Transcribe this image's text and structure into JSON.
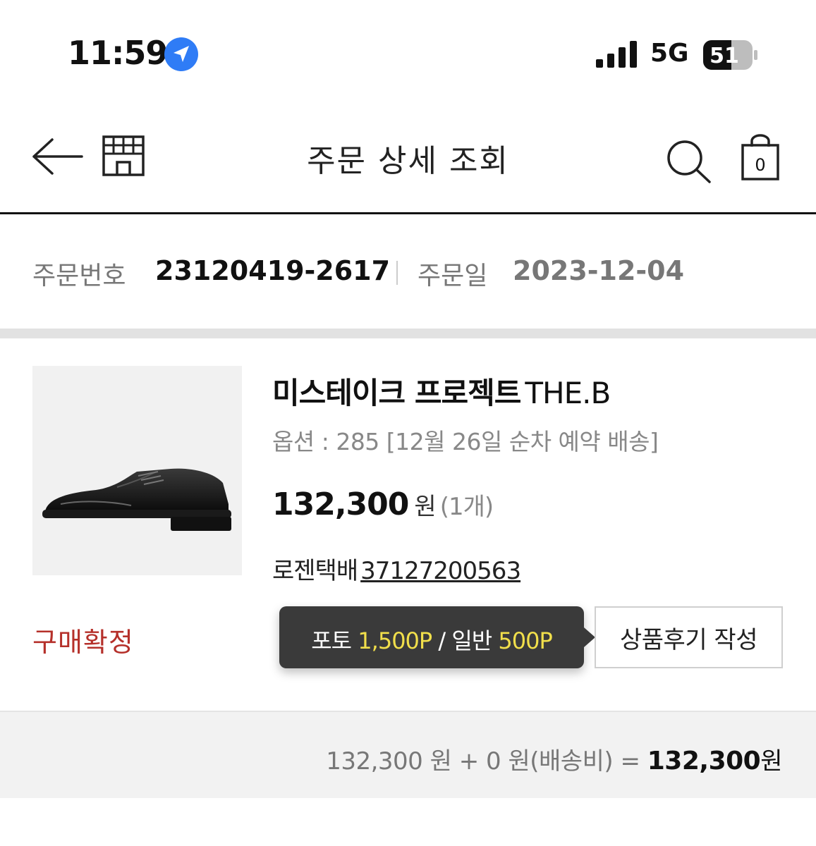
{
  "status_bar": {
    "time": "11:59",
    "network": "5G",
    "battery": "51",
    "icons": [
      "location-arrow-icon",
      "signal-bars-icon",
      "battery-icon"
    ]
  },
  "nav": {
    "title": "주문 상세 조회",
    "cart_count": "0",
    "icons": [
      "back-arrow-icon",
      "store-icon",
      "search-icon",
      "shopping-bag-icon"
    ]
  },
  "order": {
    "number_label": "주문번호",
    "number": "23120419-2617",
    "date_label": "주문일",
    "date": "2023-12-04"
  },
  "product": {
    "name": "미스테이크 프로젝트",
    "brand": "THE.B",
    "option": "옵션 : 285 [12월 26일 순차 예약 배송]",
    "price": "132,300",
    "price_unit": "원",
    "quantity": "(1개)",
    "courier": "로젠택배",
    "tracking_number": "37127200563",
    "status": "구매확정",
    "image_icon": "black-derby-shoe"
  },
  "review": {
    "tooltip_photo_label": "포토",
    "tooltip_photo_points": "1,500P",
    "tooltip_sep": "/",
    "tooltip_general_label": "일반",
    "tooltip_general_points": "500P",
    "button_label": "상품후기 작성"
  },
  "totals": {
    "item_total": "132,300 원",
    "plus": "+",
    "shipping": "0 원(배송비)",
    "equals": "=",
    "grand_total": "132,300",
    "grand_unit": "원"
  },
  "colors": {
    "status_confirmed": "#b5302a",
    "tooltip_bg": "#3a3a3a",
    "tooltip_points": "#f1df4b",
    "location_badge": "#2f7cf6"
  }
}
